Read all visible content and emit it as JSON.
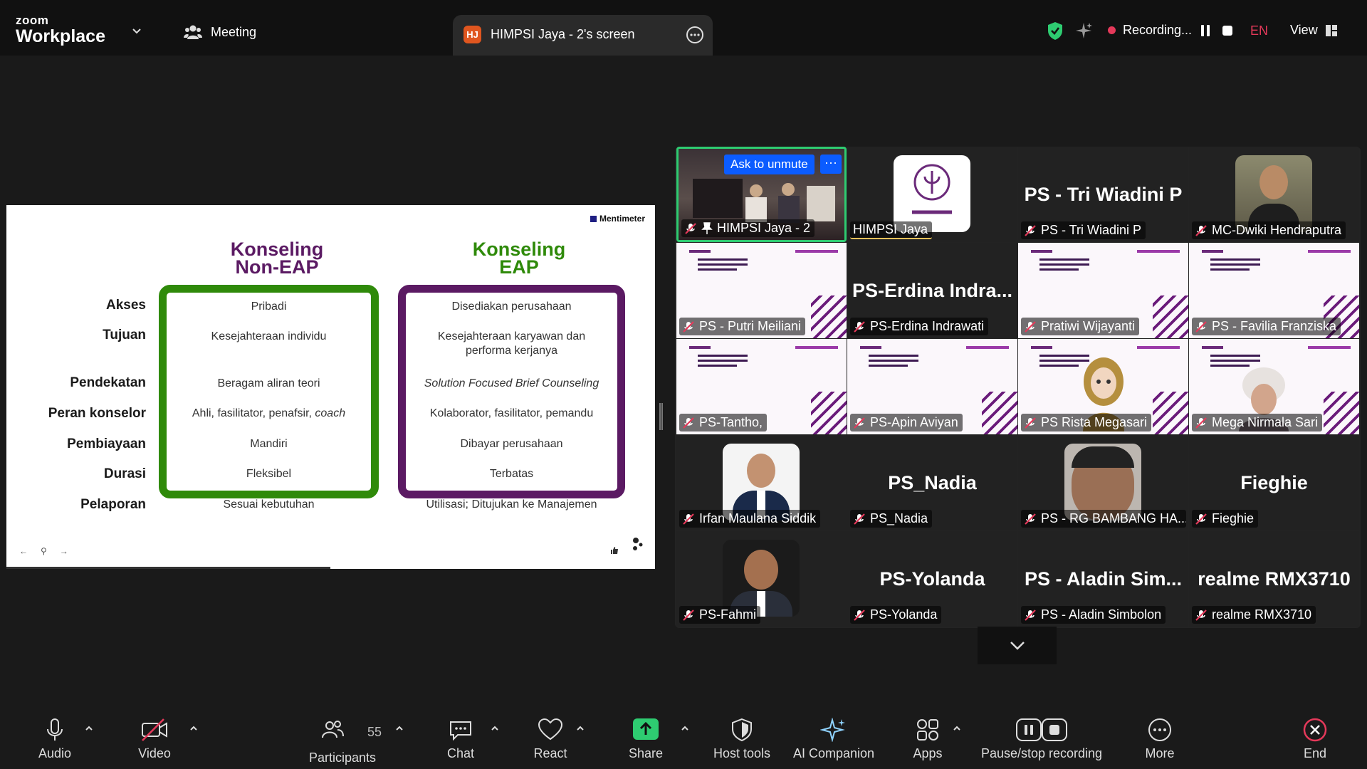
{
  "app": {
    "brand_top": "zoom",
    "brand_bottom": "Workplace"
  },
  "header": {
    "meeting_label": "Meeting",
    "share_tab": {
      "badge": "HJ",
      "title": "HIMPSI Jaya - 2's screen"
    },
    "recording_label": "Recording...",
    "language": "EN",
    "view_label": "View"
  },
  "slide": {
    "brand": "Mentimeter",
    "col1_title": [
      "Konseling",
      "Non-EAP"
    ],
    "col2_title": [
      "Konseling",
      "EAP"
    ],
    "rows": [
      {
        "label": "Akses",
        "non_eap": "Pribadi",
        "eap": "Disediakan perusahaan"
      },
      {
        "label": "Tujuan",
        "non_eap": "Kesejahteraan individu",
        "eap": "Kesejahteraan karyawan dan performa kerjanya"
      },
      {
        "label": "Pendekatan",
        "non_eap": "Beragam aliran teori",
        "eap": "Solution Focused Brief Counseling"
      },
      {
        "label": "Peran konselor",
        "non_eap_main": "Ahli, fasilitator, penafsir, ",
        "non_eap_italic": "coach",
        "eap": "Kolaborator, fasilitator, pemandu"
      },
      {
        "label": "Pembiayaan",
        "non_eap": "Mandiri",
        "eap": "Dibayar perusahaan"
      },
      {
        "label": "Durasi",
        "non_eap": "Fleksibel",
        "eap": "Terbatas"
      },
      {
        "label": "Pelaporan",
        "non_eap": "Sesuai kebutuhan",
        "eap": "Utilisasi; Ditujukan ke Manajemen"
      }
    ],
    "nav": {
      "prev": "←",
      "pin": "⚲",
      "next": "→"
    },
    "colors": {
      "non_eap": "#2f8a0a",
      "eap": "#5b1a63",
      "title_non_eap": "#5b1a63",
      "title_eap": "#2f8a0a"
    }
  },
  "gallery": {
    "active_tile": {
      "ask_unmute": "Ask to unmute",
      "more": "···"
    },
    "tiles": [
      {
        "name": "HIMPSI Jaya - 2",
        "kind": "video"
      },
      {
        "name": "HIMPSI Jaya",
        "kind": "logo"
      },
      {
        "name": "PS - Tri Wiadini P",
        "big": "PS - Tri Wiadini P",
        "kind": "text"
      },
      {
        "name": "MC-Dwiki Hendraputra",
        "kind": "photo"
      },
      {
        "name": "PS - Putri Meiliani",
        "kind": "slide"
      },
      {
        "name": "PS-Erdina Indrawati",
        "big": "PS-Erdina  Indra...",
        "kind": "text"
      },
      {
        "name": "Pratiwi Wijayanti",
        "kind": "slide"
      },
      {
        "name": "PS - Favilia Franziska",
        "kind": "slide"
      },
      {
        "name": "PS-Tantho,",
        "kind": "slide"
      },
      {
        "name": "PS-Apin Aviyan",
        "kind": "slide"
      },
      {
        "name": "PS Rista Megasari",
        "kind": "slide-avatar"
      },
      {
        "name": "Mega Nirmala Sari",
        "kind": "slide-photo"
      },
      {
        "name": "Irfan Maulana Siddik",
        "kind": "photo"
      },
      {
        "name": "PS_Nadia",
        "big": "PS_Nadia",
        "kind": "text"
      },
      {
        "name": "PS - RG BAMBANG HA...",
        "kind": "photo"
      },
      {
        "name": "Fieghie",
        "big": "Fieghie",
        "kind": "text"
      },
      {
        "name": "PS-Fahmi",
        "kind": "photo"
      },
      {
        "name": "PS-Yolanda",
        "big": "PS-Yolanda",
        "kind": "text"
      },
      {
        "name": "PS - Aladin Simbolon",
        "big": "PS - Aladin Sim...",
        "kind": "text"
      },
      {
        "name": "realme RMX3710",
        "big": "realme RMX3710",
        "kind": "text"
      }
    ]
  },
  "toolbar": {
    "audio": "Audio",
    "video": "Video",
    "participants": "Participants",
    "participants_count": "55",
    "chat": "Chat",
    "react": "React",
    "share": "Share",
    "host_tools": "Host tools",
    "ai_companion": "AI Companion",
    "apps": "Apps",
    "pause_stop": "Pause/stop recording",
    "more": "More",
    "end": "End",
    "colors": {
      "share": "#2ecc71",
      "end": "#e5395a",
      "accent": "#0b5cff"
    }
  }
}
